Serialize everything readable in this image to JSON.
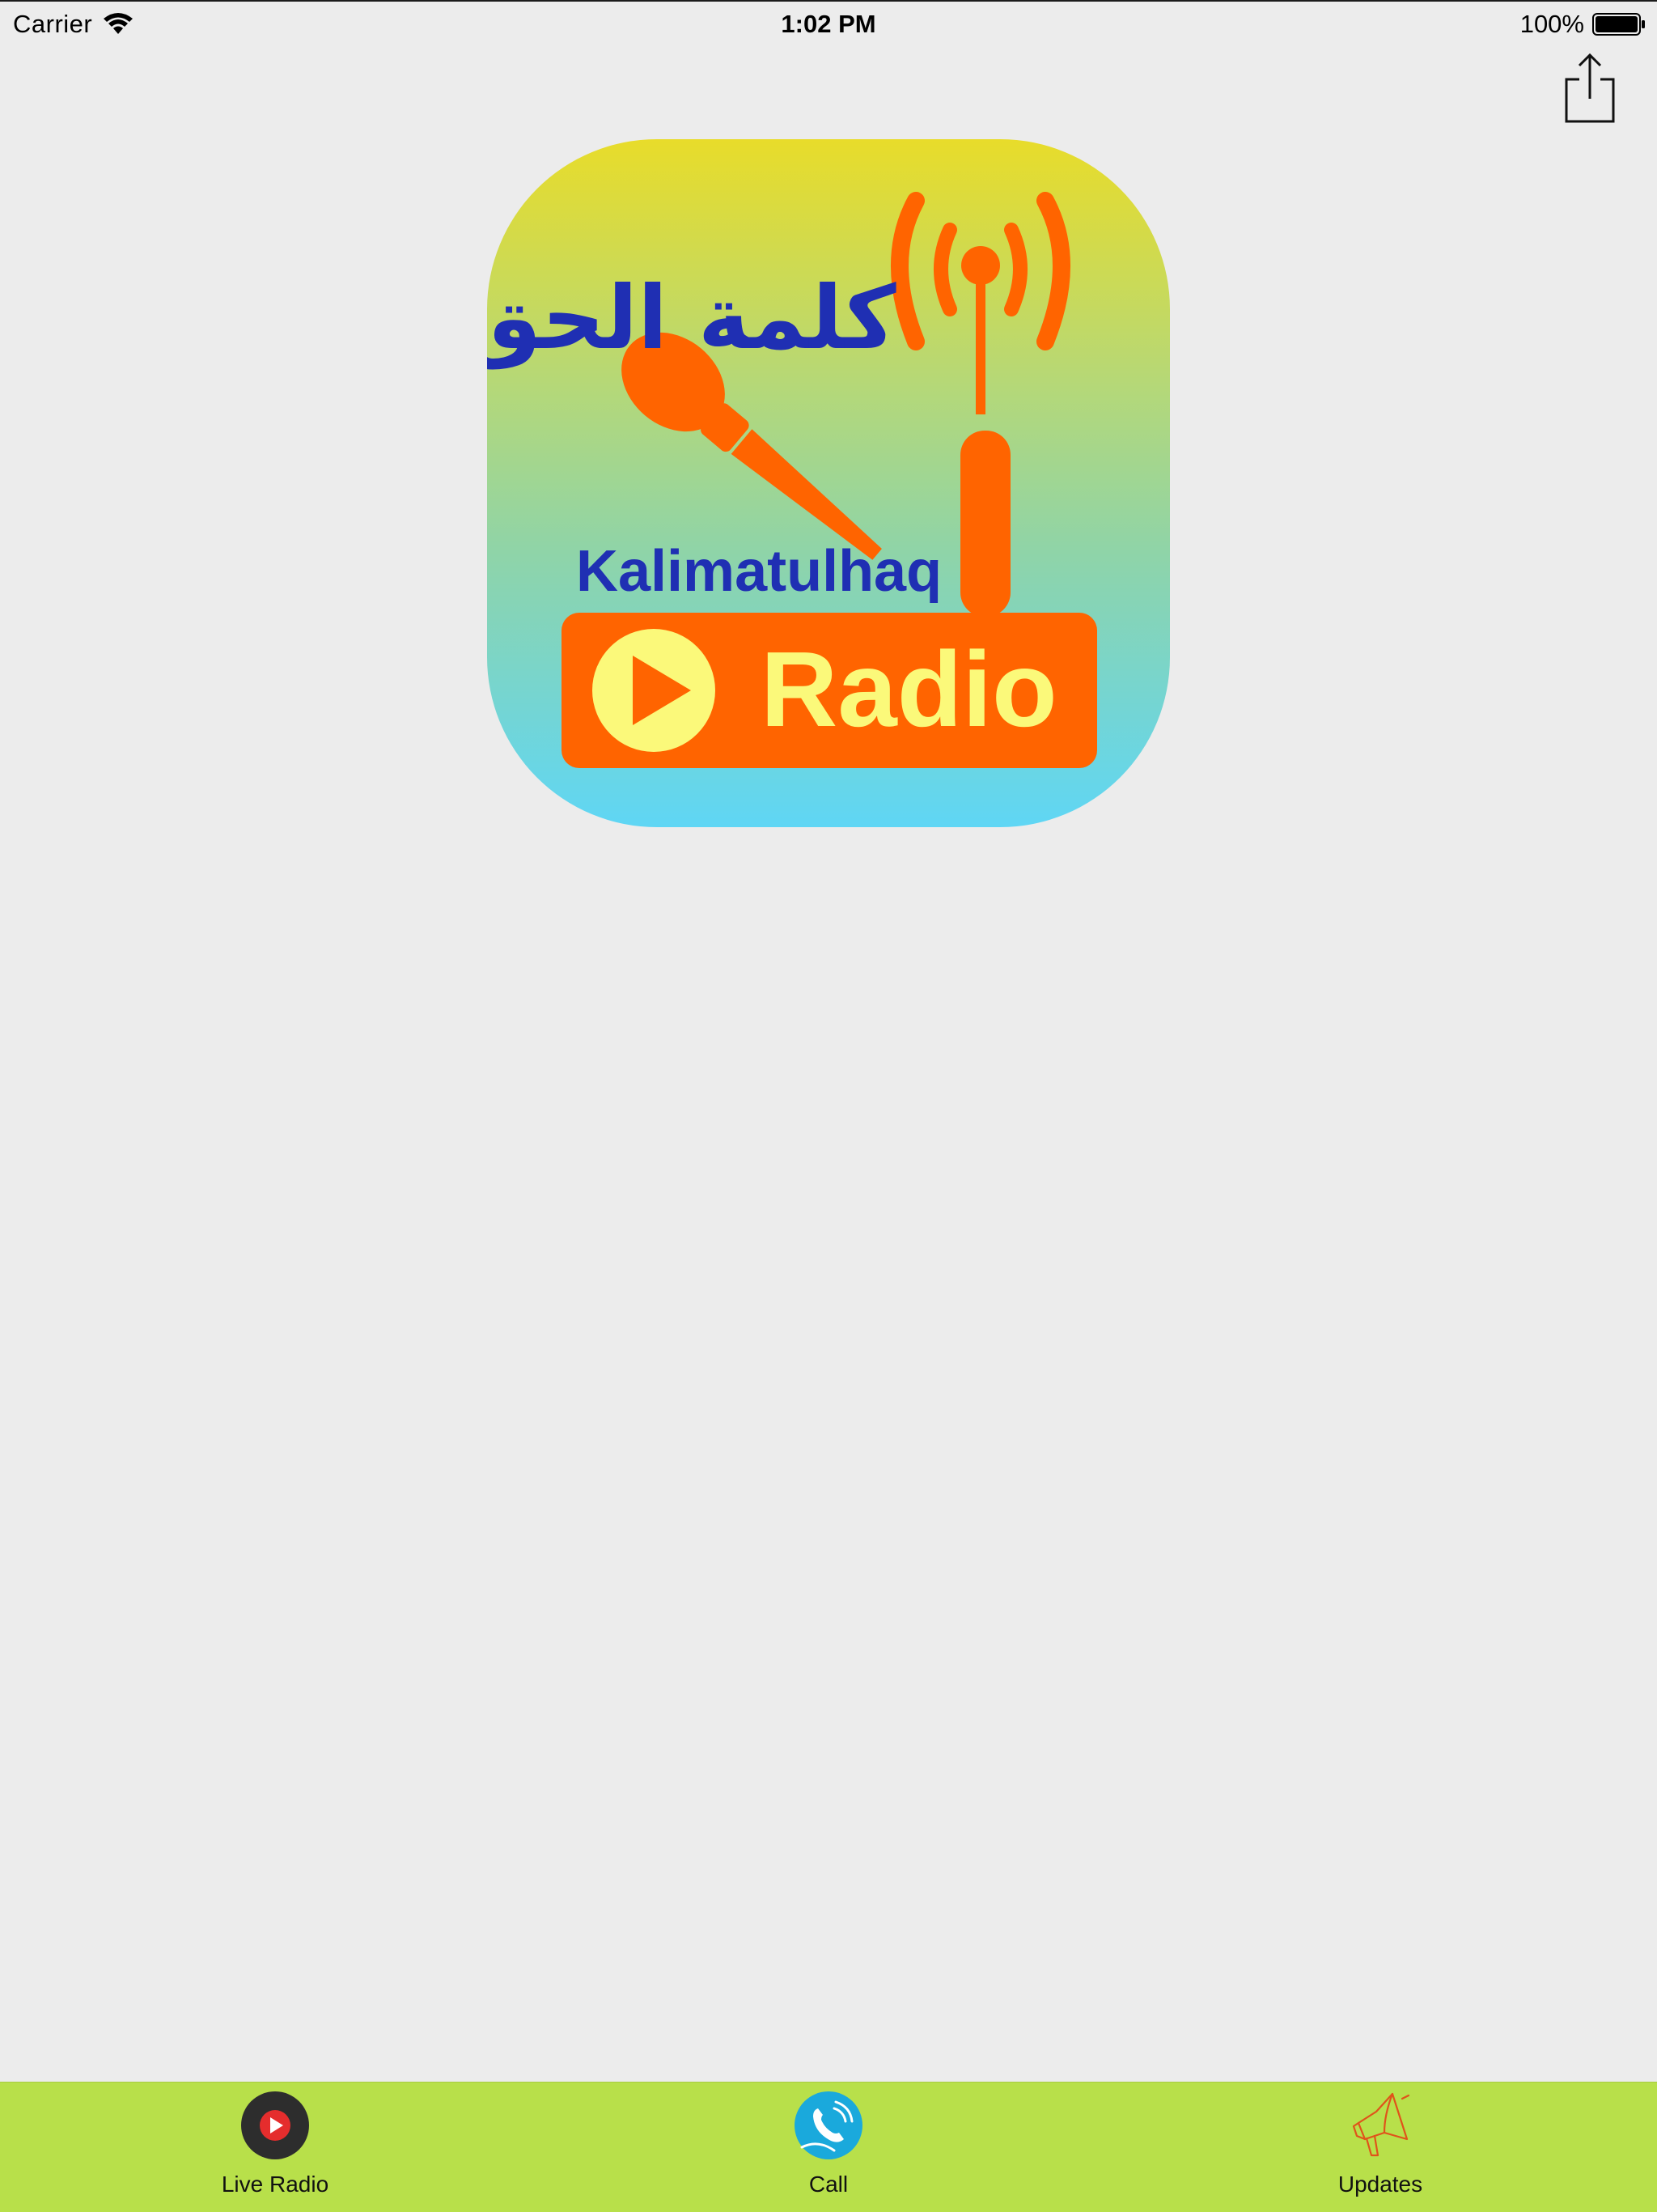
{
  "status_bar": {
    "carrier": "Carrier",
    "time": "1:02 PM",
    "battery": "100%",
    "wifi_icon": "wifi-icon",
    "battery_icon": "battery-icon"
  },
  "header": {
    "share_icon": "share-icon"
  },
  "logo": {
    "arabic_title": "كلمة الحق",
    "name": "Kalimatulhaq",
    "word": "Radio",
    "colors": {
      "gradient_top": "#e8dc2a",
      "gradient_bottom": "#5fd6f5",
      "orange": "#ff6400",
      "yellow": "#fbf97a",
      "blue": "#1f2fb3"
    }
  },
  "tab_bar": {
    "background": "#b8e04a",
    "tabs": [
      {
        "label": "Live Radio",
        "icon": "play-record-icon"
      },
      {
        "label": "Call",
        "icon": "phone-icon"
      },
      {
        "label": "Updates",
        "icon": "megaphone-icon"
      }
    ]
  }
}
